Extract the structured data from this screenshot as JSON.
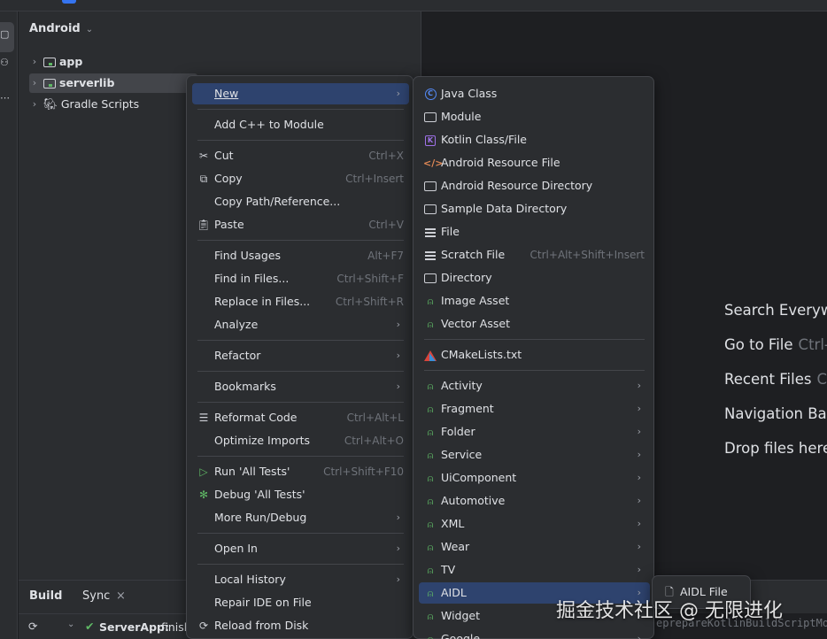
{
  "project_panel": {
    "view_selector": "Android",
    "tree": [
      {
        "label": "app"
      },
      {
        "label": "serverlib"
      },
      {
        "label": "Gradle Scripts"
      }
    ]
  },
  "context_menu": {
    "items": {
      "new": {
        "label": "New"
      },
      "add_cpp": {
        "label": "Add C++ to Module"
      },
      "cut": {
        "label": "Cut",
        "shortcut": "Ctrl+X"
      },
      "copy": {
        "label": "Copy",
        "shortcut": "Ctrl+Insert"
      },
      "copy_path": {
        "label": "Copy Path/Reference..."
      },
      "paste": {
        "label": "Paste",
        "shortcut": "Ctrl+V"
      },
      "find_usages": {
        "label": "Find Usages",
        "shortcut": "Alt+F7"
      },
      "find_in_files": {
        "label": "Find in Files...",
        "shortcut": "Ctrl+Shift+F"
      },
      "replace_in_files": {
        "label": "Replace in Files...",
        "shortcut": "Ctrl+Shift+R"
      },
      "analyze": {
        "label": "Analyze"
      },
      "refactor": {
        "label": "Refactor"
      },
      "bookmarks": {
        "label": "Bookmarks"
      },
      "reformat": {
        "label": "Reformat Code",
        "shortcut": "Ctrl+Alt+L"
      },
      "optimize": {
        "label": "Optimize Imports",
        "shortcut": "Ctrl+Alt+O"
      },
      "run_tests": {
        "label": "Run 'All Tests'",
        "shortcut": "Ctrl+Shift+F10"
      },
      "debug_tests": {
        "label": "Debug 'All Tests'"
      },
      "more_run": {
        "label": "More Run/Debug"
      },
      "open_in": {
        "label": "Open In"
      },
      "local_history": {
        "label": "Local History"
      },
      "repair_ide": {
        "label": "Repair IDE on File"
      },
      "reload": {
        "label": "Reload from Disk"
      }
    }
  },
  "new_submenu": {
    "items": {
      "java_class": {
        "label": "Java Class"
      },
      "module": {
        "label": "Module"
      },
      "kotlin": {
        "label": "Kotlin Class/File"
      },
      "res_file": {
        "label": "Android Resource File"
      },
      "res_dir": {
        "label": "Android Resource Directory"
      },
      "sample_dir": {
        "label": "Sample Data Directory"
      },
      "file": {
        "label": "File"
      },
      "scratch": {
        "label": "Scratch File",
        "shortcut": "Ctrl+Alt+Shift+Insert"
      },
      "directory": {
        "label": "Directory"
      },
      "image_asset": {
        "label": "Image Asset"
      },
      "vector_asset": {
        "label": "Vector Asset"
      },
      "cmake": {
        "label": "CMakeLists.txt"
      },
      "activity": {
        "label": "Activity"
      },
      "fragment": {
        "label": "Fragment"
      },
      "folder": {
        "label": "Folder"
      },
      "service": {
        "label": "Service"
      },
      "uicomponent": {
        "label": "UiComponent"
      },
      "automotive": {
        "label": "Automotive"
      },
      "xml": {
        "label": "XML"
      },
      "wear": {
        "label": "Wear"
      },
      "tv": {
        "label": "TV"
      },
      "aidl": {
        "label": "AIDL"
      },
      "widget": {
        "label": "Widget"
      },
      "google": {
        "label": "Google"
      }
    }
  },
  "aidl_submenu": {
    "item": "AIDL File"
  },
  "editor_hints": [
    {
      "label": "Search Everywh",
      "key": ""
    },
    {
      "label": "Go to File",
      "key": "Ctrl-"
    },
    {
      "label": "Recent Files",
      "key": "Ct"
    },
    {
      "label": "Navigation Bar",
      "key": ""
    },
    {
      "label": "Drop files here",
      "key": ""
    }
  ],
  "build_panel": {
    "tab_build": "Build",
    "tab_sync": "Sync",
    "status": "ServerApp:",
    "status_suffix": "finish",
    "console_text": "eprepareKotlinBuildScriptMo"
  },
  "watermark": "掘金技术社区 @ 无限进化",
  "colors": {
    "accent": "#3574f0",
    "selection": "#2e436e",
    "android_green": "#5fb865"
  }
}
